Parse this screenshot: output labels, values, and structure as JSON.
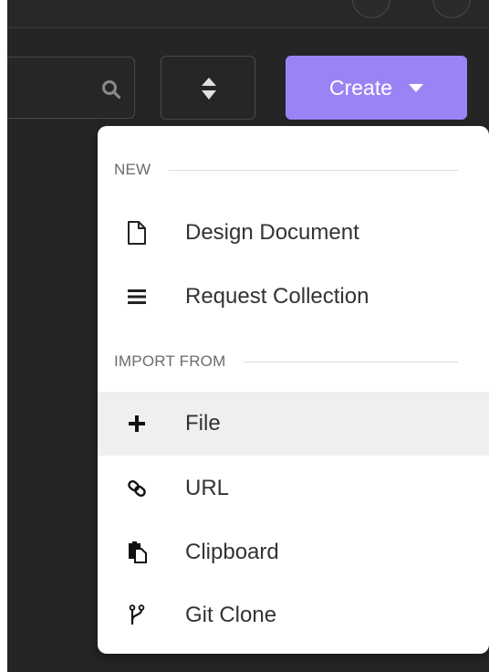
{
  "toolbar": {
    "search_icon": "search-icon",
    "sort_icon": "sort-icon",
    "create_label": "Create"
  },
  "menu": {
    "sections": [
      {
        "header": "NEW",
        "items": [
          {
            "label": "Design Document",
            "icon": "document-icon"
          },
          {
            "label": "Request Collection",
            "icon": "menu-lines-icon"
          }
        ]
      },
      {
        "header": "IMPORT FROM",
        "items": [
          {
            "label": "File",
            "icon": "plus-icon",
            "highlighted": true
          },
          {
            "label": "URL",
            "icon": "link-icon"
          },
          {
            "label": "Clipboard",
            "icon": "clipboard-icon"
          },
          {
            "label": "Git Clone",
            "icon": "git-branch-icon"
          }
        ]
      }
    ]
  },
  "colors": {
    "background": "#252525",
    "accent": "#9a84f5",
    "menu_background": "#ffffff",
    "hover": "#efefef",
    "text": "#333333",
    "section_text": "#6b6b6b"
  }
}
